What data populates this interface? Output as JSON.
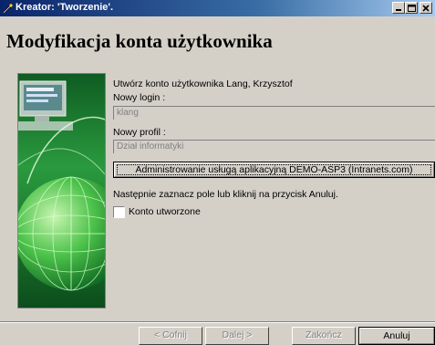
{
  "window": {
    "title": "Kreator: 'Tworzenie'.",
    "icon": "wizard-wand-icon",
    "controls": [
      "minimize-icon",
      "maximize-icon",
      "close-icon"
    ]
  },
  "page": {
    "heading": "Modyfikacja konta użytkownika"
  },
  "content": {
    "intro": "Utwórz konto użytkownika Lang, Krzysztof",
    "login_label": "Nowy login :",
    "login_value": "klang",
    "profile_label": "Nowy profil :",
    "profile_value": "Dział informatyki",
    "service_button": "Administrowanie usługą aplikacyjną DEMO-ASP3 (Intranets.com)",
    "instruction": "Następnie zaznacz pole lub kliknij na przycisk Anuluj.",
    "checkbox_label": "Konto utworzone",
    "checkbox_checked": false
  },
  "buttons": {
    "back": "< Cofnij",
    "next": "Dalej >",
    "finish": "Zakończ",
    "cancel": "Anuluj"
  },
  "colors": {
    "titlebar_start": "#0a246a",
    "titlebar_end": "#a6caf0",
    "dialog_bg": "#d4d0c8",
    "picture_green": "#1b7a2a"
  }
}
